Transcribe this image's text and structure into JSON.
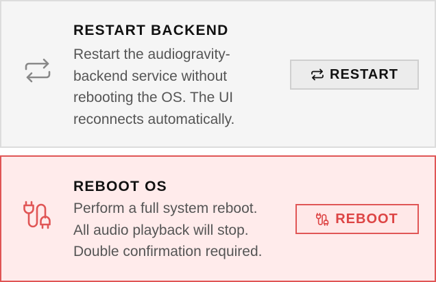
{
  "restart": {
    "title": "RESTART BACKEND",
    "description_lines": [
      "Restart the audiogravity-",
      "backend service without",
      "rebooting the OS. The UI",
      "reconnects automatically."
    ],
    "button_label": "RESTART",
    "icon": "refresh-arrows-icon"
  },
  "reboot": {
    "title": "REBOOT OS",
    "description_lines": [
      "Perform a full system reboot.",
      "All audio playback will stop.",
      "Double confirmation required."
    ],
    "button_label": "REBOOT",
    "icon": "power-plug-icon"
  },
  "colors": {
    "danger": "#e05555",
    "danger_bg": "#ffebeb",
    "neutral_bg": "#f5f5f5",
    "icon_gray": "#888888"
  }
}
